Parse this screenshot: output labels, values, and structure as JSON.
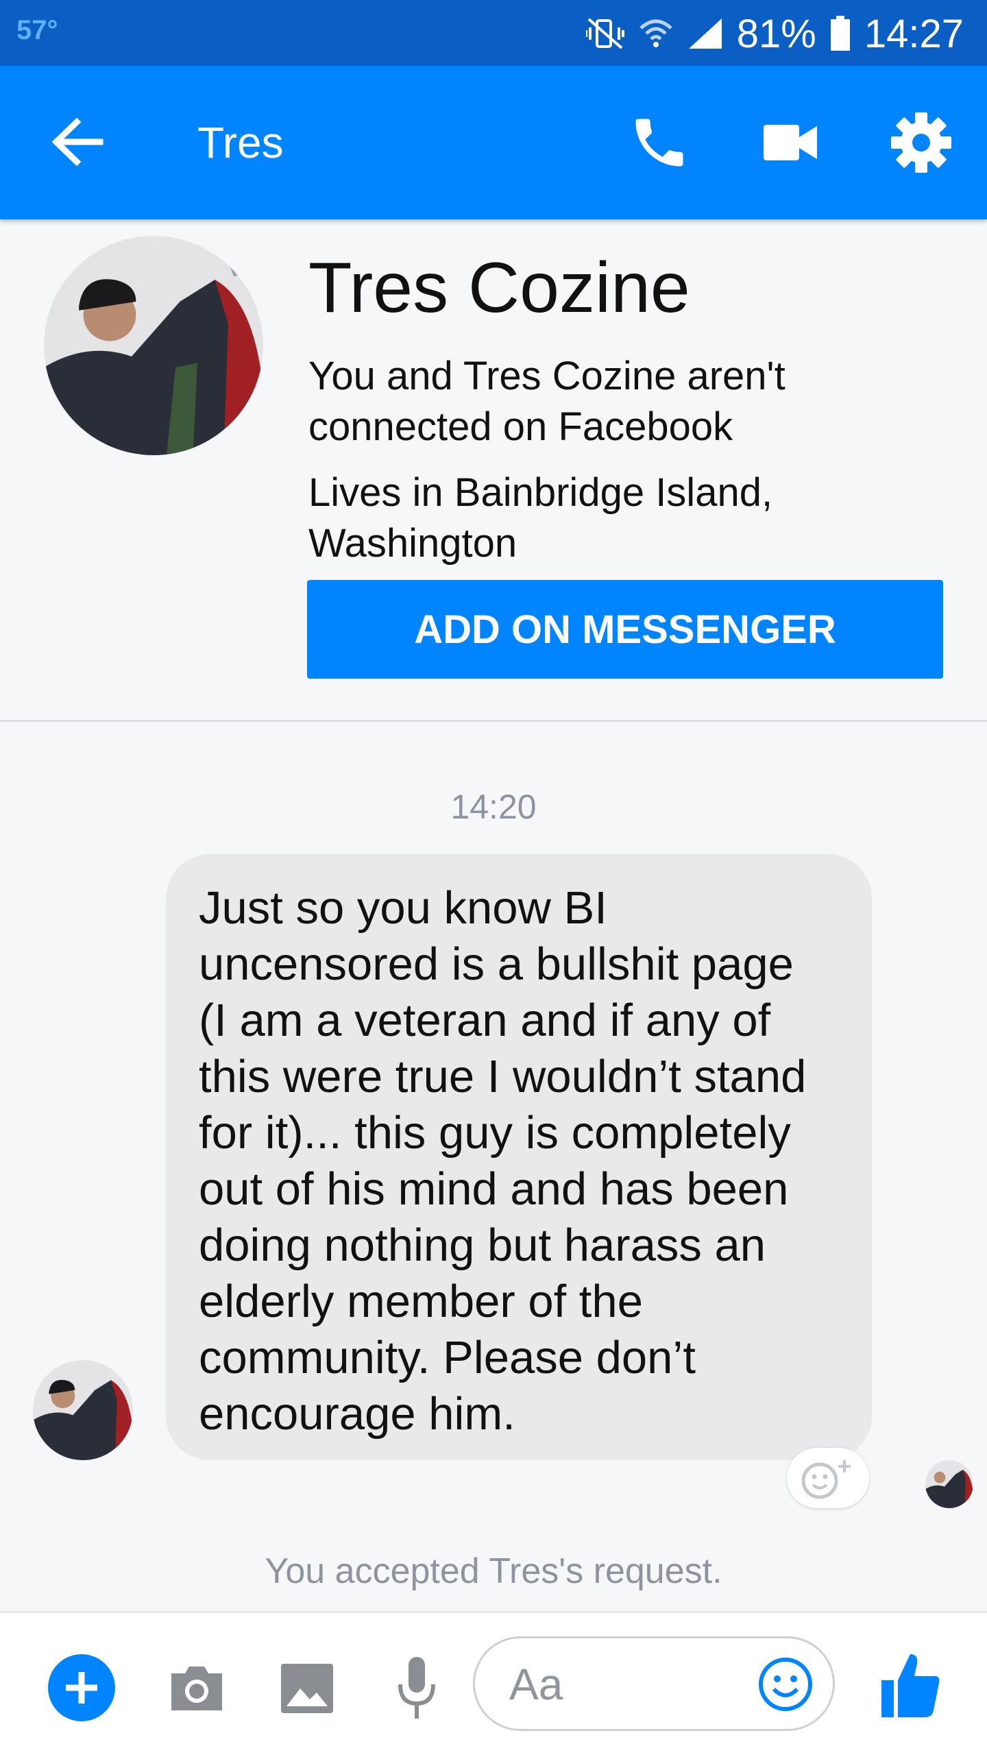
{
  "status_bar": {
    "temperature": "57°",
    "battery": "81%",
    "time": "14:27"
  },
  "header": {
    "title": "Tres",
    "icons": [
      "back-arrow-icon",
      "phone-icon",
      "video-camera-icon",
      "gear-icon"
    ]
  },
  "profile": {
    "name": "Tres Cozine",
    "connection_line1": "You and Tres Cozine aren't",
    "connection_line2": "connected on Facebook",
    "lives_line1": "Lives in Bainbridge Island,",
    "lives_line2": "Washington",
    "add_button": "ADD ON MESSENGER"
  },
  "conversation": {
    "timestamp": "14:20",
    "message_lines": [
      "Just so you know BI",
      "uncensored is a bullshit page",
      "(I am a veteran and if any of",
      "this were true I wouldn’t stand",
      "for it)... this guy is completely",
      "out of his mind and has been",
      "doing nothing but harass an",
      "elderly member of the",
      "community.  Please don’t",
      "encourage him."
    ],
    "system_message": "You accepted Tres's request."
  },
  "composer": {
    "placeholder": "Aa",
    "icons": [
      "plus-icon",
      "camera-icon",
      "image-icon",
      "microphone-icon",
      "emoji-icon",
      "thumbs-up-icon"
    ]
  },
  "colors": {
    "status_bar": "#0a5ec4",
    "brand_blue": "#0084ff",
    "bubble_gray": "#e9e9eb",
    "meta_gray": "#8d949e"
  }
}
